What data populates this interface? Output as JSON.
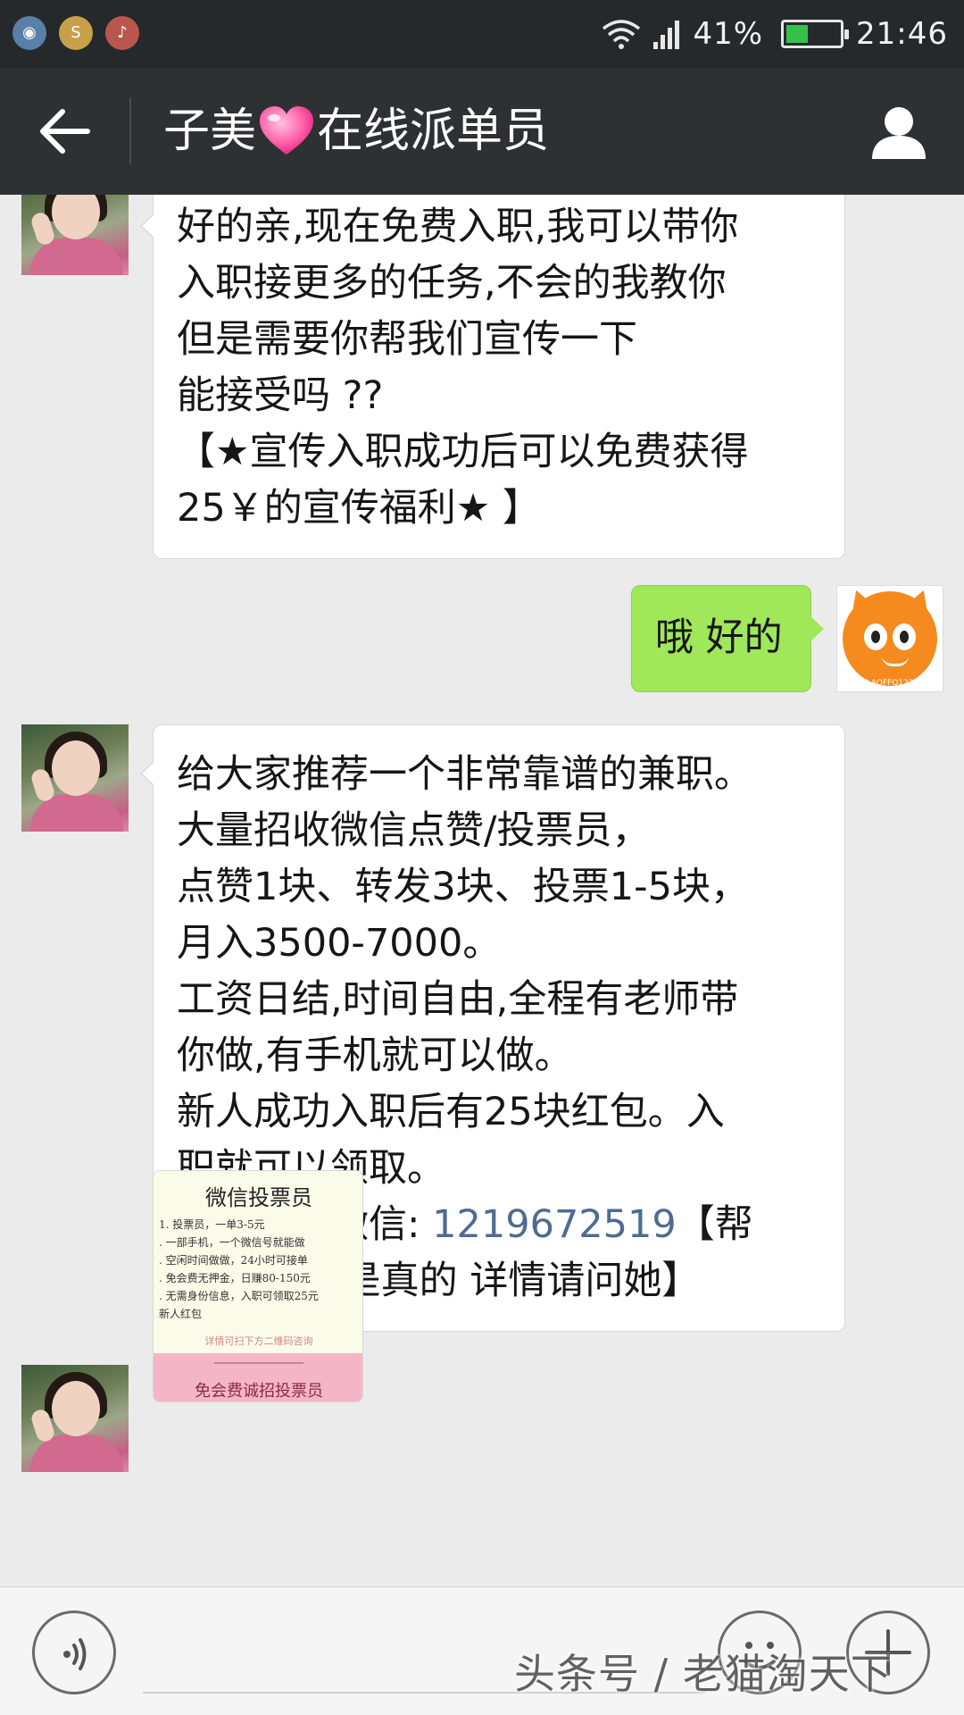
{
  "status_bar": {
    "battery_percent": "41%",
    "time": "21:46",
    "battery_level": 0.41,
    "colors": {
      "background": "#26292c",
      "battery_fill": "#36c24a"
    },
    "notification_icons": [
      "app-icon",
      "sohu-icon",
      "listen-icon"
    ]
  },
  "header": {
    "title_part1": "子美",
    "title_part2": "在线派单员",
    "colors": {
      "background": "#2e3134",
      "heart": "#ff5fa8"
    }
  },
  "messages": {
    "msg1": {
      "sender": "left",
      "lines": [
        "好的亲,现在免费入职,我可以带你",
        "入职接更多的任务,不会的我教你",
        "但是需要你帮我们宣传一下",
        "能接受吗 ??",
        "【★宣传入职成功后可以免费获得",
        "25￥的宣传福利★ 】"
      ]
    },
    "msg2": {
      "sender": "right",
      "text": "哦 好的",
      "bubble_color": "#a0e75a"
    },
    "msg3": {
      "sender": "left",
      "lines": [
        "给大家推荐一个非常靠谱的兼职。",
        "大量招收微信点赞/投票员，",
        "点赞1块、转发3块、投票1-5块，",
        "月入3500-7000。",
        "工资日结,时间自由,全程有老师带",
        "你做,有手机就可以做。",
        "新人成功入职后有25块红包。入",
        "职就可以领取。"
      ],
      "contact_prefix": "想做加她微信: ",
      "contact_number": "1219672519",
      "contact_suffix": "【帮",
      "last_line": "朋友转发 是真的 详情请问她】",
      "link_color": "#4f6b92"
    },
    "msg4": {
      "sender": "left",
      "poster": {
        "title": "微信投票员",
        "items": [
          "1. 投票员，一单3-5元",
          ". 一部手机，一个微信号就能做",
          ". 空闲时间做做，24小时可接单",
          ". 免会费无押金，日赚80-150元",
          ". 无需身份信息，入职可领取25元",
          "新人红包"
        ],
        "hint": "详情可扫下方二维码咨询",
        "band_text": "免会费诚招投票员",
        "band_color": "#f4b6c6"
      }
    }
  },
  "my_avatar": {
    "caption": "LAOFFQ123",
    "color": "#f58a1f"
  },
  "input_bar": {
    "watermark": "头条号 / 老猫淘天下"
  }
}
